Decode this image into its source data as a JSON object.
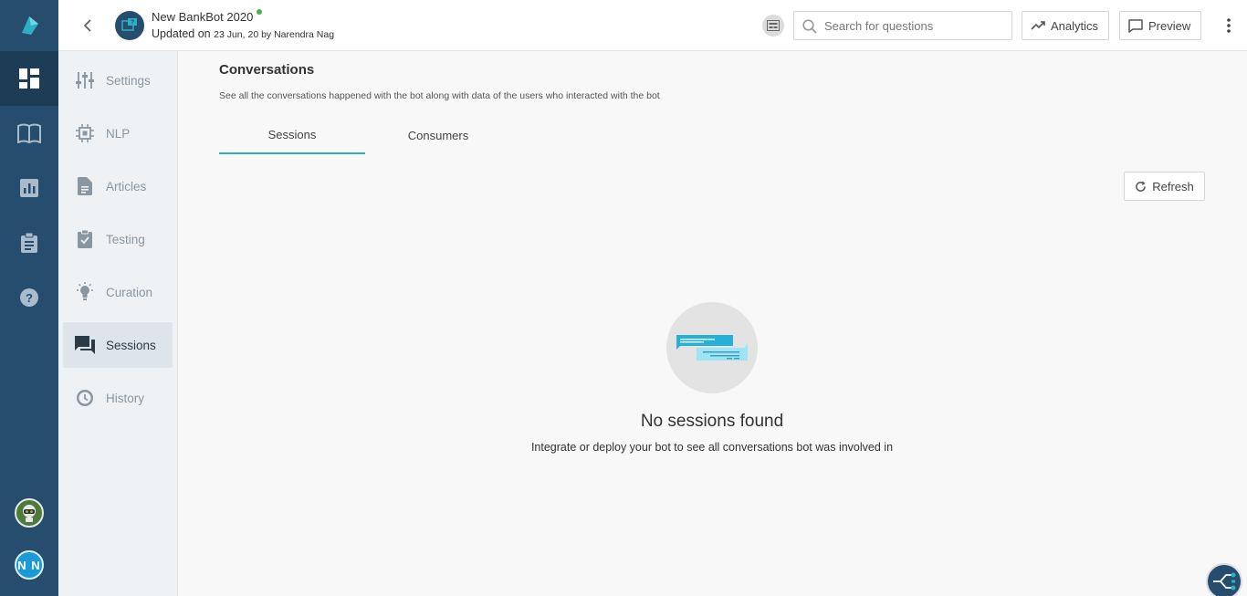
{
  "colors": {
    "rail": "#264d6e",
    "accent": "#2cb1c4",
    "status_online": "#4caf50"
  },
  "rail": {
    "logo_icon": "brand-logo-icon",
    "items": [
      {
        "icon": "dashboard-icon",
        "active": true
      },
      {
        "icon": "book-icon",
        "active": false
      },
      {
        "icon": "bar-chart-icon",
        "active": false
      },
      {
        "icon": "clipboard-icon",
        "active": false
      },
      {
        "icon": "help-icon",
        "active": false
      }
    ],
    "user_initials": "N N"
  },
  "header": {
    "bot_name": "New BankBot 2020",
    "updated_prefix": "Updated on",
    "updated_detail": "23 Jun, 20 by Narendra Nag",
    "search_placeholder": "Search for questions",
    "analytics_label": "Analytics",
    "preview_label": "Preview"
  },
  "subnav": {
    "items": [
      {
        "label": "Settings",
        "icon": "sliders-icon"
      },
      {
        "label": "NLP",
        "icon": "chip-icon"
      },
      {
        "label": "Articles",
        "icon": "document-icon"
      },
      {
        "label": "Testing",
        "icon": "clipboard-check-icon"
      },
      {
        "label": "Curation",
        "icon": "lightbulb-icon"
      },
      {
        "label": "Sessions",
        "icon": "chat-icon",
        "active": true
      },
      {
        "label": "History",
        "icon": "history-icon"
      }
    ]
  },
  "main": {
    "title": "Conversations",
    "subtitle": "See all the conversations happened with the bot along with data of the users who interacted with the bot",
    "tabs": [
      {
        "label": "Sessions",
        "active": true
      },
      {
        "label": "Consumers",
        "active": false
      }
    ],
    "refresh_label": "Refresh",
    "empty_title": "No sessions found",
    "empty_desc": "Integrate or deploy your bot to see all conversations bot was involved in"
  }
}
